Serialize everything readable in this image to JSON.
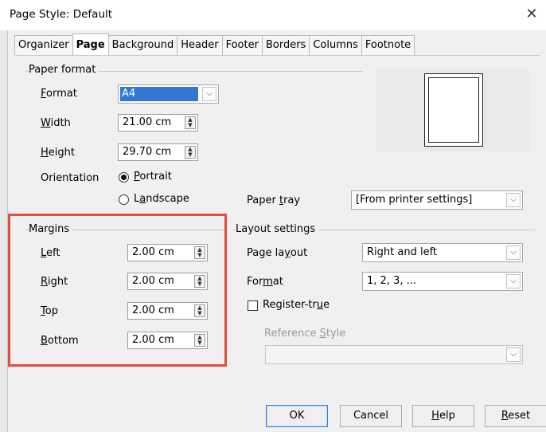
{
  "window": {
    "title": "Page Style: Default",
    "close_glyph": "✕"
  },
  "tabs": [
    {
      "label": "Organizer"
    },
    {
      "label": "Page"
    },
    {
      "label": "Background"
    },
    {
      "label": "Header"
    },
    {
      "label": "Footer"
    },
    {
      "label": "Borders"
    },
    {
      "label": "Columns"
    },
    {
      "label": "Footnote"
    }
  ],
  "paper_format": {
    "legend": "Paper format",
    "format": {
      "pre": "",
      "key": "F",
      "post": "ormat",
      "value": "A4"
    },
    "width": {
      "pre": "",
      "key": "W",
      "post": "idth",
      "value": "21.00 cm"
    },
    "height": {
      "pre": "",
      "key": "H",
      "post": "eight",
      "value": "29.70 cm"
    },
    "orientation": {
      "label": "Orientation"
    },
    "portrait": {
      "pre": "",
      "key": "P",
      "post": "ortrait",
      "checked": true
    },
    "landscape": {
      "pre": "L",
      "key": "a",
      "post": "ndscape",
      "checked": false
    }
  },
  "paper_tray": {
    "pre": "Paper ",
    "key": "t",
    "post": "ray",
    "value": "[From printer settings]"
  },
  "margins": {
    "legend": "Margins",
    "left": {
      "pre": "",
      "key": "L",
      "post": "eft",
      "value": "2.00 cm"
    },
    "right": {
      "pre": "",
      "key": "R",
      "post": "ight",
      "value": "2.00 cm"
    },
    "top": {
      "pre": "",
      "key": "T",
      "post": "op",
      "value": "2.00 cm"
    },
    "bottom": {
      "pre": "",
      "key": "B",
      "post": "ottom",
      "value": "2.00 cm"
    }
  },
  "layout_settings": {
    "legend": "Layout settings",
    "page_layout": {
      "pre": "Page la",
      "key": "y",
      "post": "out",
      "value": "Right and left"
    },
    "format": {
      "pre": "For",
      "key": "m",
      "post": "at",
      "value": "1, 2, 3, ..."
    },
    "register_true": {
      "pre": "Register-tr",
      "key": "u",
      "post": "e",
      "checked": false
    },
    "reference_style": {
      "pre": "Reference ",
      "key": "S",
      "post": "tyle",
      "value": ""
    }
  },
  "buttons": {
    "ok": {
      "label": "OK"
    },
    "cancel": {
      "label": "Cancel"
    },
    "help": {
      "pre": "",
      "key": "H",
      "post": "elp"
    },
    "reset": {
      "pre": "",
      "key": "R",
      "post": "eset"
    }
  },
  "colors": {
    "highlight": "#e14c43",
    "selection": "#3477d2",
    "default_button_border": "#3c7fd1"
  },
  "icons": {
    "spin": "spin-arrows-icon",
    "dropdown": "chevron-down-icon",
    "close": "close-icon"
  }
}
